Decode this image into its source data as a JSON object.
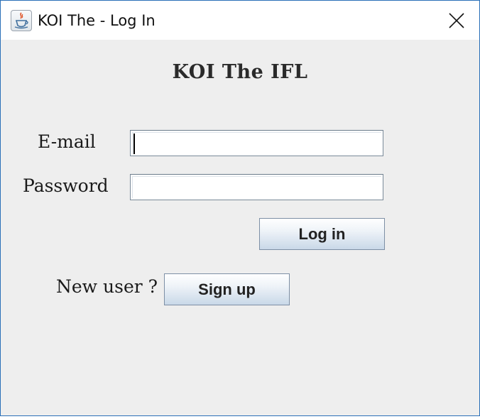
{
  "window": {
    "title": "KOI The - Log In"
  },
  "form": {
    "heading": "KOI The IFL",
    "email_label": "E-mail",
    "email_value": "",
    "password_label": "Password",
    "password_value": "",
    "login_button": "Log in",
    "new_user_label": "New user ?",
    "signup_button": "Sign up"
  },
  "icons": {
    "app": "java-coffee-cup-icon",
    "close": "close-icon"
  },
  "colors": {
    "window_border": "#2a6fb8",
    "content_background": "#eeeeee",
    "button_gradient_bottom": "#c9d8e8"
  }
}
